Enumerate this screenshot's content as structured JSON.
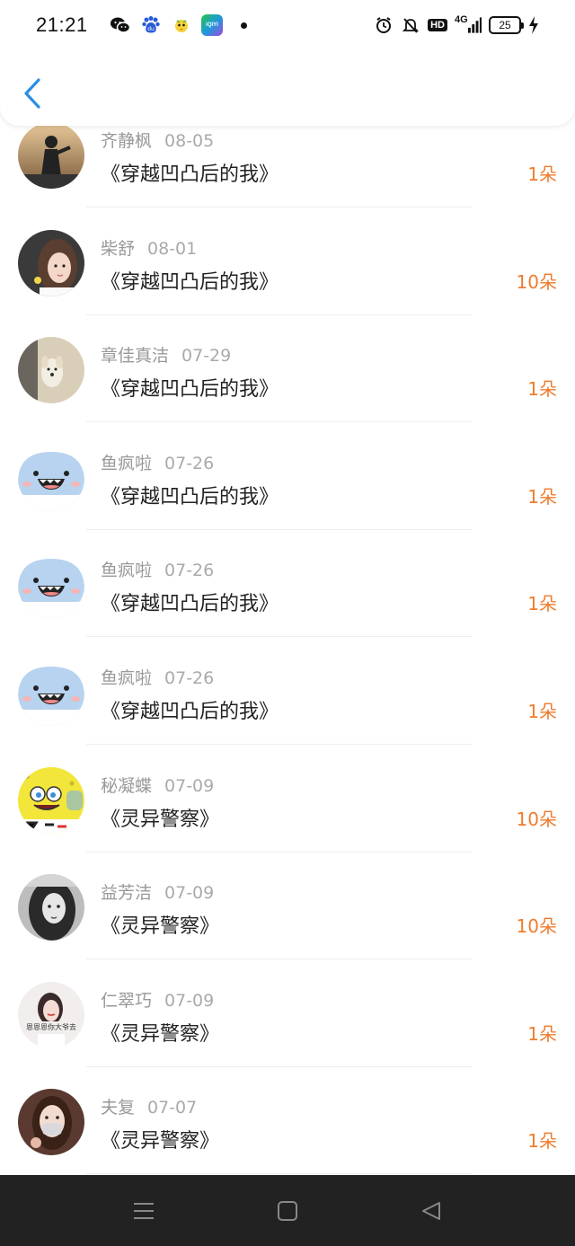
{
  "status_bar": {
    "time": "21:21",
    "network": "4G",
    "battery": "25",
    "apps": [
      "wechat-icon",
      "baidu-icon",
      "bird-app-icon",
      "iqiyi-icon"
    ],
    "iqiyi_label": "iQIYI",
    "hd_label": "HD"
  },
  "header": {
    "back_icon": "chevron-left-icon",
    "accent": "#2a8ee6"
  },
  "colors": {
    "flowers": "#ee7c2d",
    "title": "#222222",
    "meta": "#999999"
  },
  "rows": [
    {
      "name": "齐静枫",
      "date": "08-05",
      "book": "《穿越凹凸后的我》",
      "flowers": "1朵",
      "avatar": "silhouette-photo"
    },
    {
      "name": "柴舒",
      "date": "08-01",
      "book": "《穿越凹凸后的我》",
      "flowers": "10朵",
      "avatar": "girl-photo"
    },
    {
      "name": "章佳真洁",
      "date": "07-29",
      "book": "《穿越凹凸后的我》",
      "flowers": "1朵",
      "avatar": "dog-photo"
    },
    {
      "name": "鱼疯啦",
      "date": "07-26",
      "book": "《穿越凹凸后的我》",
      "flowers": "1朵",
      "avatar": "fish-cartoon"
    },
    {
      "name": "鱼疯啦",
      "date": "07-26",
      "book": "《穿越凹凸后的我》",
      "flowers": "1朵",
      "avatar": "fish-cartoon"
    },
    {
      "name": "鱼疯啦",
      "date": "07-26",
      "book": "《穿越凹凸后的我》",
      "flowers": "1朵",
      "avatar": "fish-cartoon"
    },
    {
      "name": "秘凝蝶",
      "date": "07-09",
      "book": "《灵异警察》",
      "flowers": "10朵",
      "avatar": "spongebob-cartoon"
    },
    {
      "name": "益芳洁",
      "date": "07-09",
      "book": "《灵异警察》",
      "flowers": "10朵",
      "avatar": "bw-girl-photo"
    },
    {
      "name": "仁翠巧",
      "date": "07-09",
      "book": "《灵异警察》",
      "flowers": "1朵",
      "avatar": "woman-text-photo"
    },
    {
      "name": "夫复",
      "date": "07-07",
      "book": "《灵异警察》",
      "flowers": "1朵",
      "avatar": "masked-girl-photo"
    }
  ],
  "nav_bar": {
    "buttons": [
      "menu-icon",
      "home-icon",
      "back-triangle-icon"
    ]
  }
}
